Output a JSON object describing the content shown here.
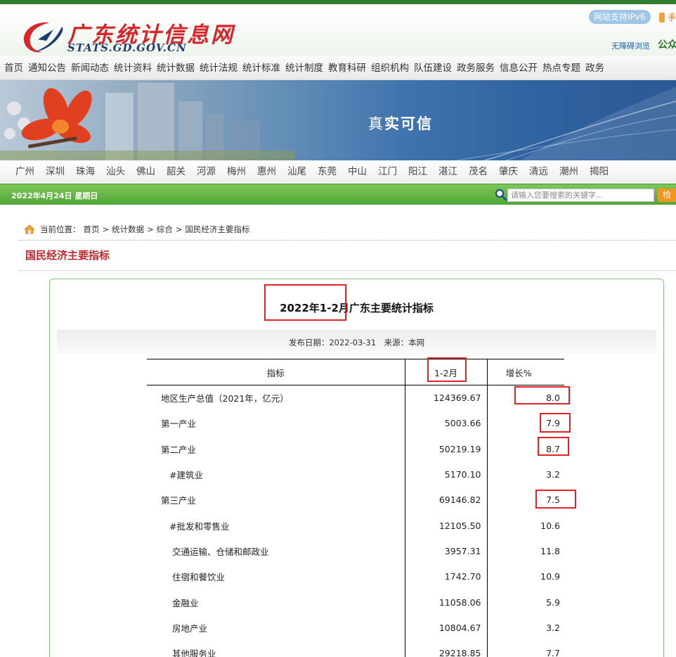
{
  "header": {
    "logo_cn": "广东统计信息网",
    "logo_en": "STATS.GD.GOV.CN",
    "ipv6": "网站支持IPv6",
    "mobile": "手",
    "accessible": "无障碍浏览",
    "public_account": "公众"
  },
  "nav": [
    "首页",
    "通知公告",
    "新闻动态",
    "统计资料",
    "统计数据",
    "统计法规",
    "统计标准",
    "统计制度",
    "教育科研",
    "组织机构",
    "队伍建设",
    "政务服务",
    "信息公开",
    "热点专题",
    "政务"
  ],
  "banner": {
    "slogan_a": "真",
    "slogan_b": "实可信"
  },
  "cities": [
    "广州",
    "深圳",
    "珠海",
    "汕头",
    "佛山",
    "韶关",
    "河源",
    "梅州",
    "惠州",
    "汕尾",
    "东莞",
    "中山",
    "江门",
    "阳江",
    "湛江",
    "茂名",
    "肇庆",
    "清远",
    "潮州",
    "揭阳"
  ],
  "datebar": {
    "date": "2022年4月24日 星期日",
    "search_placeholder": "请输入您要搜索的关键字...",
    "search_button": "检"
  },
  "breadcrumb": {
    "label": "当前位置：",
    "items": [
      "首页",
      "统计数据",
      "综合",
      "国民经济主要指标"
    ]
  },
  "section_title": "国民经济主要指标",
  "article": {
    "title": "2022年1-2月广东主要统计指标",
    "meta": "发布日期：2022-03-31　来源：本网"
  },
  "table": {
    "headers": [
      "指标",
      "1-2月",
      "增长%"
    ],
    "rows": [
      {
        "name": "地区生产总值（2021年，亿元）",
        "value": "124369.67",
        "growth": "8.0"
      },
      {
        "name": "第一产业",
        "value": "5003.66",
        "growth": "7.9"
      },
      {
        "name": "第二产业",
        "value": "50219.19",
        "growth": "8.7"
      },
      {
        "name": "#建筑业",
        "value": "5170.10",
        "growth": "3.2"
      },
      {
        "name": "第三产业",
        "value": "69146.82",
        "growth": "7.5"
      },
      {
        "name": "#批发和零售业",
        "value": "12105.50",
        "growth": "10.6"
      },
      {
        "name": "交通运输、仓储和邮政业",
        "value": "3957.31",
        "growth": "11.8"
      },
      {
        "name": "住宿和餐饮业",
        "value": "1742.70",
        "growth": "10.9"
      },
      {
        "name": "金融业",
        "value": "11058.06",
        "growth": "5.9"
      },
      {
        "name": "房地产业",
        "value": "10804.67",
        "growth": "3.2"
      },
      {
        "name": "其他服务业",
        "value": "29218.85",
        "growth": "7.7"
      }
    ]
  },
  "colors": {
    "brand_green": "#4fa735",
    "title_red": "#c1272d",
    "annotation_red": "#e02424"
  }
}
